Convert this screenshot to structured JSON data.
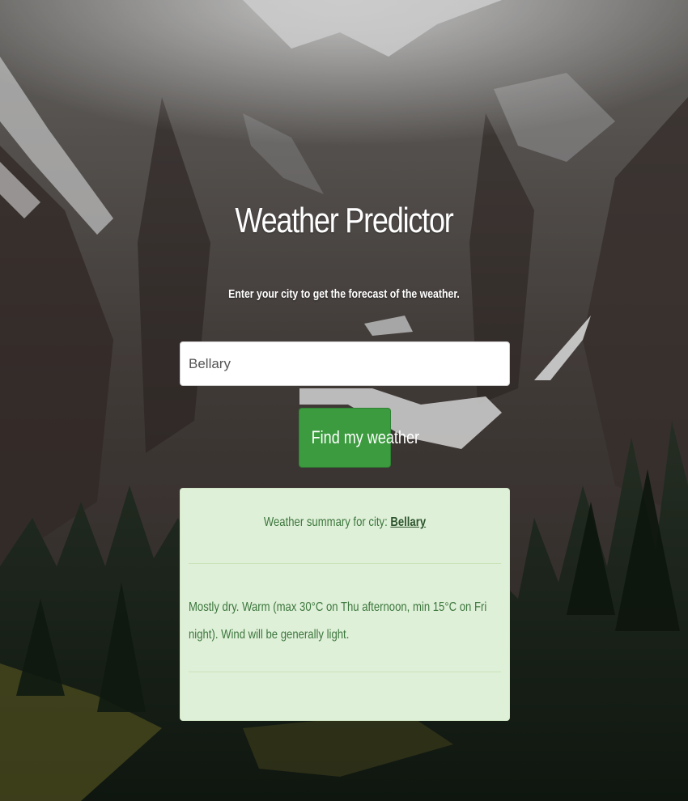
{
  "app": {
    "title": "Weather Predictor",
    "subtitle": "Enter your city to get the forecast of the weather."
  },
  "search": {
    "value": "Bellary",
    "button_label": "Find my weather"
  },
  "result": {
    "summary_prefix": "Weather summary for city:",
    "city": "Bellary",
    "forecast": "Mostly dry. Warm (max 30°C on Thu afternoon, min 15°C on Fri night). Wind will be generally light."
  },
  "colors": {
    "button": "#3c9b3f",
    "result_background": "#dff0d8",
    "result_text": "#3c763d"
  }
}
